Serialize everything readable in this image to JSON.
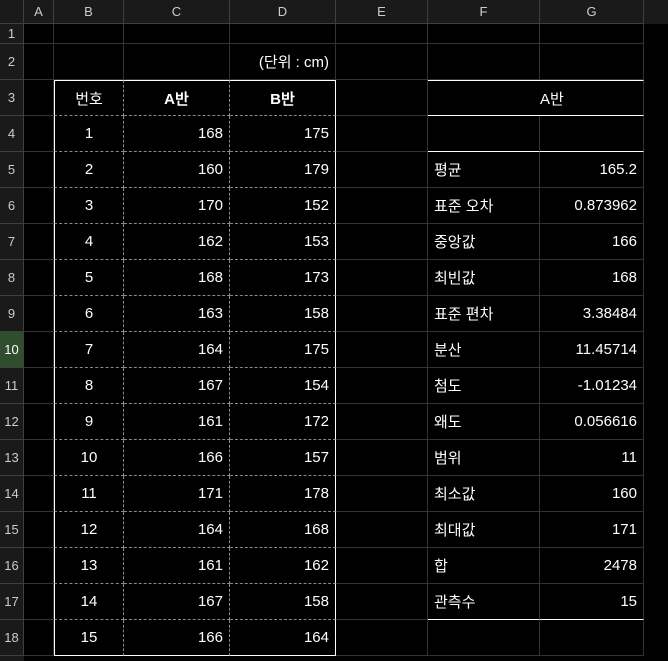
{
  "columns": [
    "A",
    "B",
    "C",
    "D",
    "E",
    "F",
    "G"
  ],
  "rows": [
    1,
    2,
    3,
    4,
    5,
    6,
    7,
    8,
    9,
    10,
    11,
    12,
    13,
    14,
    15,
    16,
    17,
    18
  ],
  "selected_row": 10,
  "unit_label": "(단위 : cm)",
  "header": {
    "num": "번호",
    "classA": "A반",
    "classB": "B반"
  },
  "data_rows": [
    {
      "num": "1",
      "a": "168",
      "b": "175"
    },
    {
      "num": "2",
      "a": "160",
      "b": "179"
    },
    {
      "num": "3",
      "a": "170",
      "b": "152"
    },
    {
      "num": "4",
      "a": "162",
      "b": "153"
    },
    {
      "num": "5",
      "a": "168",
      "b": "173"
    },
    {
      "num": "6",
      "a": "163",
      "b": "158"
    },
    {
      "num": "7",
      "a": "164",
      "b": "175"
    },
    {
      "num": "8",
      "a": "167",
      "b": "154"
    },
    {
      "num": "9",
      "a": "161",
      "b": "172"
    },
    {
      "num": "10",
      "a": "166",
      "b": "157"
    },
    {
      "num": "11",
      "a": "171",
      "b": "178"
    },
    {
      "num": "12",
      "a": "164",
      "b": "168"
    },
    {
      "num": "13",
      "a": "161",
      "b": "162"
    },
    {
      "num": "14",
      "a": "167",
      "b": "158"
    },
    {
      "num": "15",
      "a": "166",
      "b": "164"
    }
  ],
  "stats_title": "A반",
  "stats": [
    {
      "label": "평균",
      "value": "165.2"
    },
    {
      "label": "표준 오차",
      "value": "0.873962"
    },
    {
      "label": "중앙값",
      "value": "166"
    },
    {
      "label": "최빈값",
      "value": "168"
    },
    {
      "label": "표준 편차",
      "value": "3.38484"
    },
    {
      "label": "분산",
      "value": "11.45714"
    },
    {
      "label": "첨도",
      "value": "-1.01234"
    },
    {
      "label": "왜도",
      "value": "0.056616"
    },
    {
      "label": "범위",
      "value": "11"
    },
    {
      "label": "최소값",
      "value": "160"
    },
    {
      "label": "최대값",
      "value": "171"
    },
    {
      "label": "합",
      "value": "2478"
    },
    {
      "label": "관측수",
      "value": "15"
    }
  ]
}
